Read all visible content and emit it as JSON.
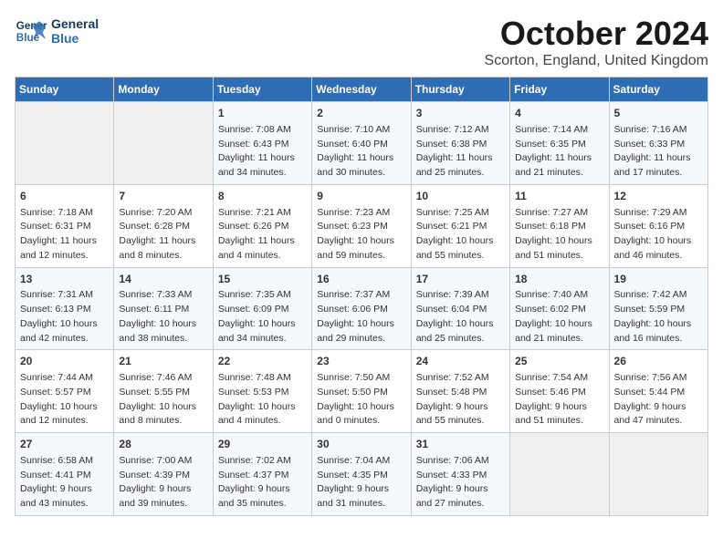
{
  "logo": {
    "line1": "General",
    "line2": "Blue"
  },
  "title": "October 2024",
  "location": "Scorton, England, United Kingdom",
  "days_of_week": [
    "Sunday",
    "Monday",
    "Tuesday",
    "Wednesday",
    "Thursday",
    "Friday",
    "Saturday"
  ],
  "weeks": [
    [
      {
        "day": "",
        "info": ""
      },
      {
        "day": "",
        "info": ""
      },
      {
        "day": "1",
        "info": "Sunrise: 7:08 AM\nSunset: 6:43 PM\nDaylight: 11 hours\nand 34 minutes."
      },
      {
        "day": "2",
        "info": "Sunrise: 7:10 AM\nSunset: 6:40 PM\nDaylight: 11 hours\nand 30 minutes."
      },
      {
        "day": "3",
        "info": "Sunrise: 7:12 AM\nSunset: 6:38 PM\nDaylight: 11 hours\nand 25 minutes."
      },
      {
        "day": "4",
        "info": "Sunrise: 7:14 AM\nSunset: 6:35 PM\nDaylight: 11 hours\nand 21 minutes."
      },
      {
        "day": "5",
        "info": "Sunrise: 7:16 AM\nSunset: 6:33 PM\nDaylight: 11 hours\nand 17 minutes."
      }
    ],
    [
      {
        "day": "6",
        "info": "Sunrise: 7:18 AM\nSunset: 6:31 PM\nDaylight: 11 hours\nand 12 minutes."
      },
      {
        "day": "7",
        "info": "Sunrise: 7:20 AM\nSunset: 6:28 PM\nDaylight: 11 hours\nand 8 minutes."
      },
      {
        "day": "8",
        "info": "Sunrise: 7:21 AM\nSunset: 6:26 PM\nDaylight: 11 hours\nand 4 minutes."
      },
      {
        "day": "9",
        "info": "Sunrise: 7:23 AM\nSunset: 6:23 PM\nDaylight: 10 hours\nand 59 minutes."
      },
      {
        "day": "10",
        "info": "Sunrise: 7:25 AM\nSunset: 6:21 PM\nDaylight: 10 hours\nand 55 minutes."
      },
      {
        "day": "11",
        "info": "Sunrise: 7:27 AM\nSunset: 6:18 PM\nDaylight: 10 hours\nand 51 minutes."
      },
      {
        "day": "12",
        "info": "Sunrise: 7:29 AM\nSunset: 6:16 PM\nDaylight: 10 hours\nand 46 minutes."
      }
    ],
    [
      {
        "day": "13",
        "info": "Sunrise: 7:31 AM\nSunset: 6:13 PM\nDaylight: 10 hours\nand 42 minutes."
      },
      {
        "day": "14",
        "info": "Sunrise: 7:33 AM\nSunset: 6:11 PM\nDaylight: 10 hours\nand 38 minutes."
      },
      {
        "day": "15",
        "info": "Sunrise: 7:35 AM\nSunset: 6:09 PM\nDaylight: 10 hours\nand 34 minutes."
      },
      {
        "day": "16",
        "info": "Sunrise: 7:37 AM\nSunset: 6:06 PM\nDaylight: 10 hours\nand 29 minutes."
      },
      {
        "day": "17",
        "info": "Sunrise: 7:39 AM\nSunset: 6:04 PM\nDaylight: 10 hours\nand 25 minutes."
      },
      {
        "day": "18",
        "info": "Sunrise: 7:40 AM\nSunset: 6:02 PM\nDaylight: 10 hours\nand 21 minutes."
      },
      {
        "day": "19",
        "info": "Sunrise: 7:42 AM\nSunset: 5:59 PM\nDaylight: 10 hours\nand 16 minutes."
      }
    ],
    [
      {
        "day": "20",
        "info": "Sunrise: 7:44 AM\nSunset: 5:57 PM\nDaylight: 10 hours\nand 12 minutes."
      },
      {
        "day": "21",
        "info": "Sunrise: 7:46 AM\nSunset: 5:55 PM\nDaylight: 10 hours\nand 8 minutes."
      },
      {
        "day": "22",
        "info": "Sunrise: 7:48 AM\nSunset: 5:53 PM\nDaylight: 10 hours\nand 4 minutes."
      },
      {
        "day": "23",
        "info": "Sunrise: 7:50 AM\nSunset: 5:50 PM\nDaylight: 10 hours\nand 0 minutes."
      },
      {
        "day": "24",
        "info": "Sunrise: 7:52 AM\nSunset: 5:48 PM\nDaylight: 9 hours\nand 55 minutes."
      },
      {
        "day": "25",
        "info": "Sunrise: 7:54 AM\nSunset: 5:46 PM\nDaylight: 9 hours\nand 51 minutes."
      },
      {
        "day": "26",
        "info": "Sunrise: 7:56 AM\nSunset: 5:44 PM\nDaylight: 9 hours\nand 47 minutes."
      }
    ],
    [
      {
        "day": "27",
        "info": "Sunrise: 6:58 AM\nSunset: 4:41 PM\nDaylight: 9 hours\nand 43 minutes."
      },
      {
        "day": "28",
        "info": "Sunrise: 7:00 AM\nSunset: 4:39 PM\nDaylight: 9 hours\nand 39 minutes."
      },
      {
        "day": "29",
        "info": "Sunrise: 7:02 AM\nSunset: 4:37 PM\nDaylight: 9 hours\nand 35 minutes."
      },
      {
        "day": "30",
        "info": "Sunrise: 7:04 AM\nSunset: 4:35 PM\nDaylight: 9 hours\nand 31 minutes."
      },
      {
        "day": "31",
        "info": "Sunrise: 7:06 AM\nSunset: 4:33 PM\nDaylight: 9 hours\nand 27 minutes."
      },
      {
        "day": "",
        "info": ""
      },
      {
        "day": "",
        "info": ""
      }
    ]
  ]
}
